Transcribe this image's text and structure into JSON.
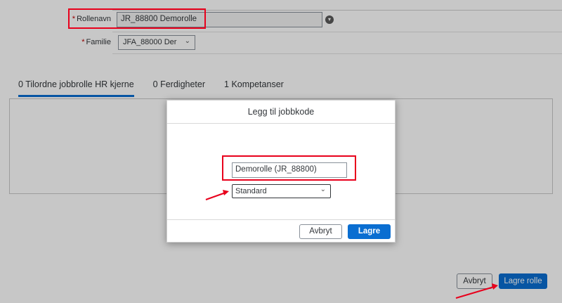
{
  "form": {
    "required_mark": "*",
    "role_name_label": "Rollenavn",
    "role_name_value": "JR_88800 Demorolle",
    "family_label": "Familie",
    "family_value": "JFA_88000 Der"
  },
  "tabs": [
    {
      "label": "0 Tilordne jobbrolle HR kjerne",
      "active": true
    },
    {
      "label": "0 Ferdigheter",
      "active": false
    },
    {
      "label": "1 Kompetanser",
      "active": false
    }
  ],
  "page_footer": {
    "cancel_label": "Avbryt",
    "save_label": "Lagre rolle"
  },
  "dialog": {
    "title": "Legg til jobbkode",
    "jobcode_value": "Demorolle (JR_88800)",
    "type_value": "Standard",
    "cancel_label": "Avbryt",
    "save_label": "Lagre"
  },
  "colors": {
    "accent": "#0a6ed1",
    "highlight": "#e8001c"
  },
  "icons": {
    "info": "info-icon",
    "chevron": "chevron-down-icon"
  }
}
